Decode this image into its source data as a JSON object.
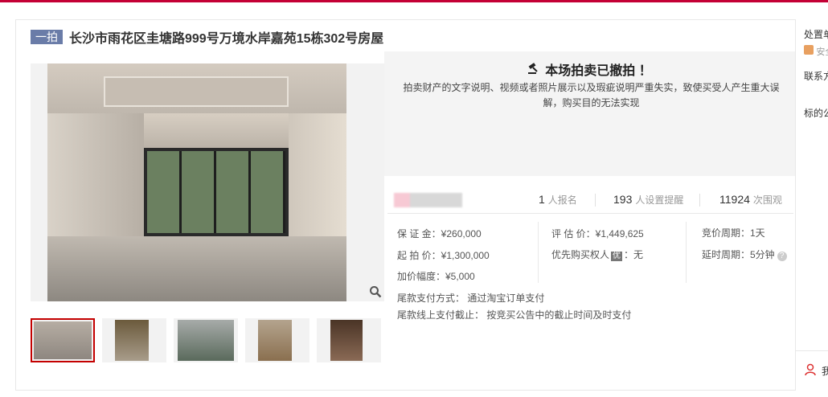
{
  "header": {
    "badge": "一拍",
    "title": "长沙市雨花区圭塘路999号万境水岸嘉苑15栋302号房屋"
  },
  "gallery": {
    "thumb_count": 5
  },
  "notice": {
    "title": "本场拍卖已撤拍 ！",
    "text": "拍卖财产的文字说明、视频或者照片展示以及瑕疵说明严重失实，致使买受人产生重大误解，购买目的无法实现"
  },
  "stats": {
    "signups": "1",
    "signups_unit": "人报名",
    "reminders": "193",
    "reminders_unit": "人设置提醒",
    "views": "11924",
    "views_unit": "次围观"
  },
  "details": {
    "deposit": "保 证 金：¥260,000",
    "start_price": "起 拍 价：¥1,300,000",
    "increment": "加价幅度：¥5,000",
    "appraisal": "评 估 价：¥1,449,625",
    "priority_label": "优先购买权人",
    "priority_tag": "优",
    "priority_value": "：无",
    "cycle": "竞价周期：1天",
    "delay": "延时周期：5分钟",
    "payment_method": "尾款支付方式： 通过淘宝订单支付",
    "payment_deadline": "尾款线上支付截止： 按竞买公告中的截止时间及时支付"
  },
  "sidebar": {
    "label1": "处置单",
    "label2": "安全",
    "label3": "联系方",
    "label4": "标的公",
    "footer_label": "我"
  }
}
